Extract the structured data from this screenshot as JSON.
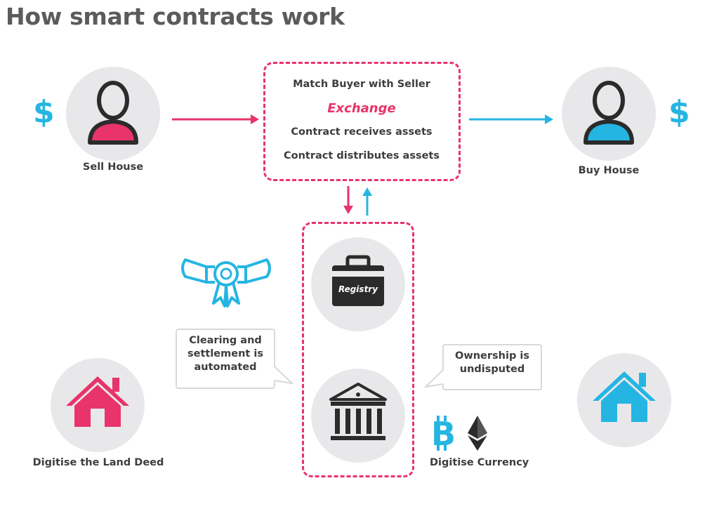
{
  "title": "How smart contracts work",
  "seller": {
    "label": "Sell House",
    "currency_symbol": "$"
  },
  "buyer": {
    "label": "Buy House",
    "currency_symbol": "$"
  },
  "contract": {
    "line1": "Match Buyer with Seller",
    "line2": "Exchange",
    "line3": "Contract receives assets",
    "line4": "Contract distributes assets"
  },
  "registry": {
    "label": "Registry"
  },
  "bubbles": {
    "clearing_line1": "Clearing and",
    "clearing_line2": "settlement is",
    "clearing_line3": "automated",
    "ownership_line1": "Ownership is",
    "ownership_line2": "undisputed"
  },
  "land_deed": {
    "label": "Digitise the Land Deed"
  },
  "currency": {
    "label": "Digitise Currency"
  },
  "colors": {
    "pink": "#e8336b",
    "blue": "#25b5e3",
    "dark": "#2b2b2b",
    "circle_bg": "#e8e8ea"
  }
}
